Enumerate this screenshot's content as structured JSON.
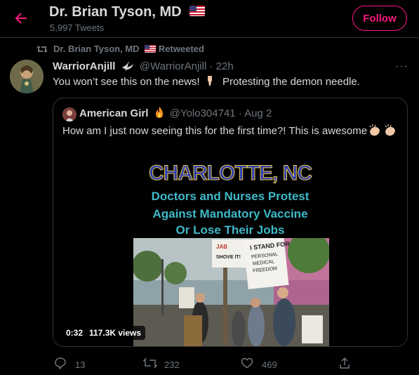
{
  "header": {
    "title": "Dr. Brian Tyson, MD",
    "tweet_count": "5,997 Tweets",
    "follow_label": "Follow"
  },
  "retweet_banner": {
    "name": "Dr. Brian Tyson, MD",
    "suffix": "Retweeted"
  },
  "tweet": {
    "author_name": "WarriorAnjill",
    "handle_time": "@WarriorAnjill · 22h",
    "text_1": "You won’t see this on the news!",
    "text_2": "Protesting the demon needle."
  },
  "quote": {
    "author_name": "American Girl",
    "handle_time": "@Yolo304741 · Aug 2",
    "text": "How am I just now seeing this for the first time?!  This is awesome",
    "video": {
      "title": "CHARLOTTE, NC",
      "line1": "Doctors and Nurses Protest",
      "line2": "Against Mandatory Vaccine",
      "line3": "Or Lose Their Jobs",
      "duration": "0:32",
      "views": "117.3K views",
      "sign1_a": "JAB",
      "sign1_b": "SHOVE IT!",
      "sign2_a": "I STAND FOR",
      "sign2_b": "PERSONAL",
      "sign2_c": "MEDICAL",
      "sign2_d": "FREEDOM"
    }
  },
  "actions": {
    "replies": "13",
    "retweets": "232",
    "likes": "469"
  },
  "colors": {
    "accent": "#f91880",
    "muted": "#6e767d",
    "border": "#2f3336"
  }
}
